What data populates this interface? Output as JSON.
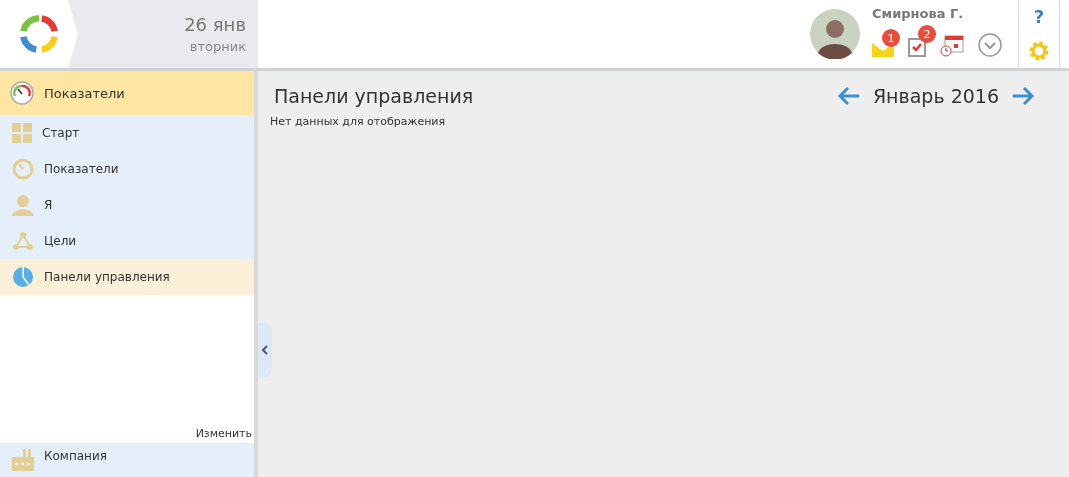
{
  "header": {
    "date": "26 янв",
    "weekday": "вторник",
    "user": {
      "name": "Смирнова Г."
    },
    "notifications": [
      {
        "kind": "mail",
        "badge": "1"
      },
      {
        "kind": "tasks",
        "badge": "2"
      },
      {
        "kind": "calendar"
      },
      {
        "kind": "more"
      }
    ],
    "help": "?"
  },
  "sidebar": {
    "section": {
      "label": "Показатели"
    },
    "items": [
      {
        "label": "Старт",
        "kind": "start",
        "selected": false
      },
      {
        "label": "Показатели",
        "kind": "indicators",
        "selected": false
      },
      {
        "label": "Я",
        "kind": "me",
        "selected": false
      },
      {
        "label": "Цели",
        "kind": "goals",
        "selected": false
      },
      {
        "label": "Панели управления",
        "kind": "dashboards",
        "selected": true
      }
    ],
    "edit_link": "Изменить",
    "bottom_section": {
      "label": "Компания"
    }
  },
  "main": {
    "title": "Панели управления",
    "period": "Январь 2016",
    "message": "Нет данных для отображения"
  }
}
